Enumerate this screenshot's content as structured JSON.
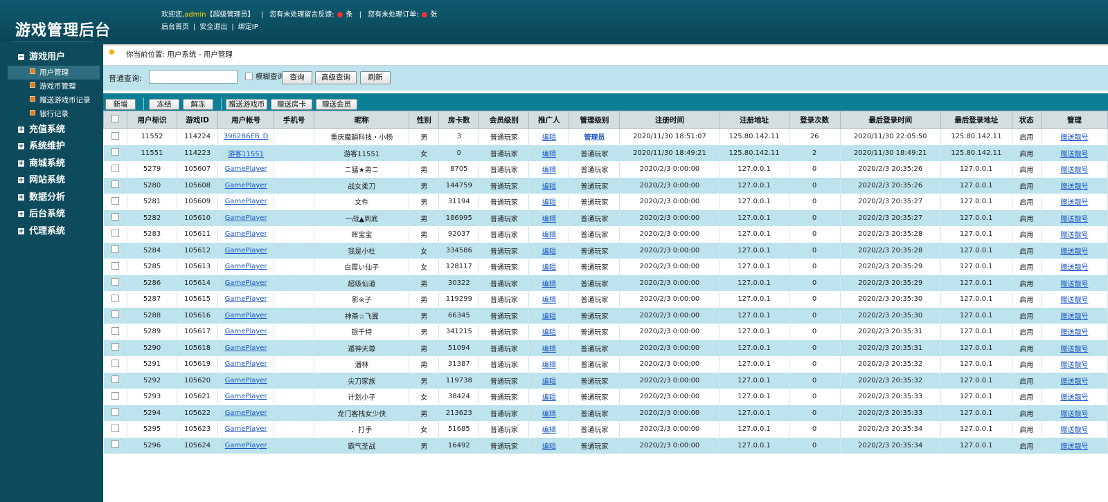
{
  "app": {
    "title": "游戏管理后台",
    "welcome": "欢迎您,",
    "user": "admin",
    "role": "【超级管理员】",
    "feedback_pre": "您有未处理留言反馈:",
    "feedback_count": "",
    "feedback_unit": "条",
    "order_pre": "您有未处理订单:",
    "order_count": "",
    "order_unit": "张",
    "links": [
      "后台首页",
      "安全退出",
      "绑定IP"
    ]
  },
  "sidebar": {
    "groups": [
      {
        "label": "游戏用户",
        "expanded": true
      },
      {
        "label": "充值系统"
      },
      {
        "label": "系统维护"
      },
      {
        "label": "商城系统"
      },
      {
        "label": "网站系统"
      },
      {
        "label": "数据分析"
      },
      {
        "label": "后台系统"
      },
      {
        "label": "代理系统"
      }
    ],
    "sub_items": [
      "用户管理",
      "游戏币管理",
      "赠送游戏币记录",
      "银行记录"
    ],
    "active_sub": "用户管理"
  },
  "breadcrumb": "你当前位置: 用户系统 - 用户管理",
  "search": {
    "label": "普通查询:",
    "value": "",
    "fuzzy_label": "模糊查询",
    "buttons": [
      "查询",
      "高级查询",
      "刷新"
    ]
  },
  "toolbar": [
    "新增",
    "冻结",
    "解冻",
    "赠送游戏币",
    "赠送房卡",
    "赠送会员"
  ],
  "table": {
    "headers": [
      "",
      "用户标识",
      "游戏ID",
      "用户帐号",
      "手机号",
      "昵称",
      "性别",
      "房卡数",
      "会员级别",
      "推广人",
      "管理级别",
      "注册时间",
      "注册地址",
      "登录次数",
      "最后登录时间",
      "最后登录地址",
      "状态",
      "管理"
    ],
    "edit_label": "编辑",
    "action_label": "赠送靓号",
    "rows": [
      {
        "uid": "11552",
        "gid": "114224",
        "account": "3962B6EB_D",
        "phone": "",
        "nick": "重庆魔韻科技・小杨",
        "sex": "男",
        "cards": "3",
        "member": "普通玩家",
        "admin": "管理员",
        "reg_time": "2020/11/30 18:51:07",
        "reg_ip": "125.80.142.11",
        "logins": "26",
        "last_time": "2020/11/30 22:05:50",
        "last_ip": "125.80.142.11",
        "status": "启用"
      },
      {
        "uid": "11551",
        "gid": "114223",
        "account": "游客11551",
        "phone": "",
        "nick": "游客11551",
        "sex": "女",
        "cards": "0",
        "member": "普通玩家",
        "admin": "普通玩家",
        "reg_time": "2020/11/30 18:49:21",
        "reg_ip": "125.80.142.11",
        "logins": "2",
        "last_time": "2020/11/30 18:49:21",
        "last_ip": "125.80.142.11",
        "status": "启用"
      },
      {
        "uid": "5279",
        "gid": "105607",
        "account": "GamePlayer",
        "phone": "",
        "nick": "ニ猛★男ニ",
        "sex": "男",
        "cards": "8705",
        "member": "普通玩家",
        "admin": "普通玩家",
        "reg_time": "2020/2/3 0:00:00",
        "reg_ip": "127.0.0.1",
        "logins": "0",
        "last_time": "2020/2/3 20:35:26",
        "last_ip": "127.0.0.1",
        "status": "启用"
      },
      {
        "uid": "5280",
        "gid": "105608",
        "account": "GamePlayer",
        "phone": "",
        "nick": "战女柔刀",
        "sex": "男",
        "cards": "144759",
        "member": "普通玩家",
        "admin": "普通玩家",
        "reg_time": "2020/2/3 0:00:00",
        "reg_ip": "127.0.0.1",
        "logins": "0",
        "last_time": "2020/2/3 20:35:26",
        "last_ip": "127.0.0.1",
        "status": "启用"
      },
      {
        "uid": "5281",
        "gid": "105609",
        "account": "GamePlayer",
        "phone": "",
        "nick": "文件",
        "sex": "男",
        "cards": "31194",
        "member": "普通玩家",
        "admin": "普通玩家",
        "reg_time": "2020/2/3 0:00:00",
        "reg_ip": "127.0.0.1",
        "logins": "0",
        "last_time": "2020/2/3 20:35:27",
        "last_ip": "127.0.0.1",
        "status": "启用"
      },
      {
        "uid": "5282",
        "gid": "105610",
        "account": "GamePlayer",
        "phone": "",
        "nick": "一战▲到底",
        "sex": "男",
        "cards": "186995",
        "member": "普通玩家",
        "admin": "普通玩家",
        "reg_time": "2020/2/3 0:00:00",
        "reg_ip": "127.0.0.1",
        "logins": "0",
        "last_time": "2020/2/3 20:35:27",
        "last_ip": "127.0.0.1",
        "status": "启用"
      },
      {
        "uid": "5283",
        "gid": "105611",
        "account": "GamePlayer",
        "phone": "",
        "nick": "晖宝宝",
        "sex": "男",
        "cards": "92037",
        "member": "普通玩家",
        "admin": "普通玩家",
        "reg_time": "2020/2/3 0:00:00",
        "reg_ip": "127.0.0.1",
        "logins": "0",
        "last_time": "2020/2/3 20:35:28",
        "last_ip": "127.0.0.1",
        "status": "启用"
      },
      {
        "uid": "5284",
        "gid": "105612",
        "account": "GamePlayer",
        "phone": "",
        "nick": "我是小杜",
        "sex": "女",
        "cards": "334586",
        "member": "普通玩家",
        "admin": "普通玩家",
        "reg_time": "2020/2/3 0:00:00",
        "reg_ip": "127.0.0.1",
        "logins": "0",
        "last_time": "2020/2/3 20:35:28",
        "last_ip": "127.0.0.1",
        "status": "启用"
      },
      {
        "uid": "5285",
        "gid": "105613",
        "account": "GamePlayer",
        "phone": "",
        "nick": "白霞い仙子",
        "sex": "女",
        "cards": "128117",
        "member": "普通玩家",
        "admin": "普通玩家",
        "reg_time": "2020/2/3 0:00:00",
        "reg_ip": "127.0.0.1",
        "logins": "0",
        "last_time": "2020/2/3 20:35:29",
        "last_ip": "127.0.0.1",
        "status": "启用"
      },
      {
        "uid": "5286",
        "gid": "105614",
        "account": "GamePlayer",
        "phone": "",
        "nick": "超级仙道",
        "sex": "男",
        "cards": "30322",
        "member": "普通玩家",
        "admin": "普通玩家",
        "reg_time": "2020/2/3 0:00:00",
        "reg_ip": "127.0.0.1",
        "logins": "0",
        "last_time": "2020/2/3 20:35:29",
        "last_ip": "127.0.0.1",
        "status": "启用"
      },
      {
        "uid": "5287",
        "gid": "105615",
        "account": "GamePlayer",
        "phone": "",
        "nick": "影※子",
        "sex": "男",
        "cards": "119299",
        "member": "普通玩家",
        "admin": "普通玩家",
        "reg_time": "2020/2/3 0:00:00",
        "reg_ip": "127.0.0.1",
        "logins": "0",
        "last_time": "2020/2/3 20:35:30",
        "last_ip": "127.0.0.1",
        "status": "启用"
      },
      {
        "uid": "5288",
        "gid": "105616",
        "account": "GamePlayer",
        "phone": "",
        "nick": "神斋☆飞翼",
        "sex": "男",
        "cards": "66345",
        "member": "普通玩家",
        "admin": "普通玩家",
        "reg_time": "2020/2/3 0:00:00",
        "reg_ip": "127.0.0.1",
        "logins": "0",
        "last_time": "2020/2/3 20:35:30",
        "last_ip": "127.0.0.1",
        "status": "启用"
      },
      {
        "uid": "5289",
        "gid": "105617",
        "account": "GamePlayer",
        "phone": "",
        "nick": "银千特",
        "sex": "男",
        "cards": "341215",
        "member": "普通玩家",
        "admin": "普通玩家",
        "reg_time": "2020/2/3 0:00:00",
        "reg_ip": "127.0.0.1",
        "logins": "0",
        "last_time": "2020/2/3 20:35:31",
        "last_ip": "127.0.0.1",
        "status": "启用"
      },
      {
        "uid": "5290",
        "gid": "105618",
        "account": "GamePlayer",
        "phone": "",
        "nick": "遁神天尊",
        "sex": "男",
        "cards": "51094",
        "member": "普通玩家",
        "admin": "普通玩家",
        "reg_time": "2020/2/3 0:00:00",
        "reg_ip": "127.0.0.1",
        "logins": "0",
        "last_time": "2020/2/3 20:35:31",
        "last_ip": "127.0.0.1",
        "status": "启用"
      },
      {
        "uid": "5291",
        "gid": "105619",
        "account": "GamePlayer",
        "phone": "",
        "nick": "潘林",
        "sex": "男",
        "cards": "31387",
        "member": "普通玩家",
        "admin": "普通玩家",
        "reg_time": "2020/2/3 0:00:00",
        "reg_ip": "127.0.0.1",
        "logins": "0",
        "last_time": "2020/2/3 20:35:32",
        "last_ip": "127.0.0.1",
        "status": "启用"
      },
      {
        "uid": "5292",
        "gid": "105620",
        "account": "GamePlayer",
        "phone": "",
        "nick": "尖刀家族",
        "sex": "男",
        "cards": "119738",
        "member": "普通玩家",
        "admin": "普通玩家",
        "reg_time": "2020/2/3 0:00:00",
        "reg_ip": "127.0.0.1",
        "logins": "0",
        "last_time": "2020/2/3 20:35:32",
        "last_ip": "127.0.0.1",
        "status": "启用"
      },
      {
        "uid": "5293",
        "gid": "105621",
        "account": "GamePlayer",
        "phone": "",
        "nick": "计划小子",
        "sex": "女",
        "cards": "38424",
        "member": "普通玩家",
        "admin": "普通玩家",
        "reg_time": "2020/2/3 0:00:00",
        "reg_ip": "127.0.0.1",
        "logins": "0",
        "last_time": "2020/2/3 20:35:33",
        "last_ip": "127.0.0.1",
        "status": "启用"
      },
      {
        "uid": "5294",
        "gid": "105622",
        "account": "GamePlayer",
        "phone": "",
        "nick": "龙门客栈女少侠",
        "sex": "男",
        "cards": "213623",
        "member": "普通玩家",
        "admin": "普通玩家",
        "reg_time": "2020/2/3 0:00:00",
        "reg_ip": "127.0.0.1",
        "logins": "0",
        "last_time": "2020/2/3 20:35:33",
        "last_ip": "127.0.0.1",
        "status": "启用"
      },
      {
        "uid": "5295",
        "gid": "105623",
        "account": "GamePlayer",
        "phone": "",
        "nick": "、打手",
        "sex": "女",
        "cards": "51685",
        "member": "普通玩家",
        "admin": "普通玩家",
        "reg_time": "2020/2/3 0:00:00",
        "reg_ip": "127.0.0.1",
        "logins": "0",
        "last_time": "2020/2/3 20:35:34",
        "last_ip": "127.0.0.1",
        "status": "启用"
      },
      {
        "uid": "5296",
        "gid": "105624",
        "account": "GamePlayer",
        "phone": "",
        "nick": "霸气圣战",
        "sex": "男",
        "cards": "16492",
        "member": "普通玩家",
        "admin": "普通玩家",
        "reg_time": "2020/2/3 0:00:00",
        "reg_ip": "127.0.0.1",
        "logins": "0",
        "last_time": "2020/2/3 20:35:34",
        "last_ip": "127.0.0.1",
        "status": "启用"
      }
    ]
  },
  "colors": {
    "header": "#0b4658",
    "sidebar": "#0d4a5c",
    "row_alt": "#bde3ec",
    "toolbar": "#0c7f97",
    "link": "#1a55c8",
    "badge": "#ff3030"
  }
}
